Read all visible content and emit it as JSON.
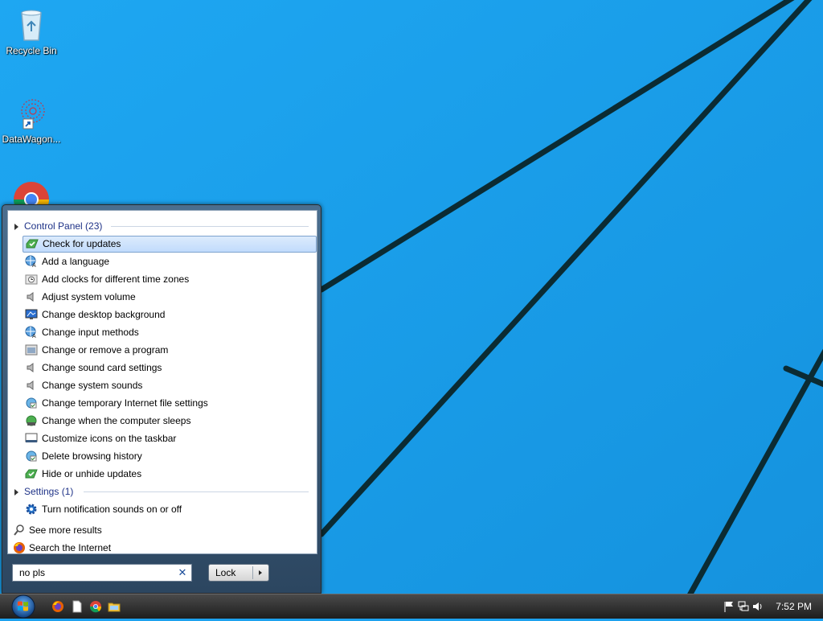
{
  "desktop": {
    "icons": [
      {
        "label": "Recycle Bin"
      },
      {
        "label": "DataWagon..."
      },
      {
        "label": ""
      }
    ]
  },
  "start_menu": {
    "groups": [
      {
        "header": "Control Panel (23)",
        "items": [
          {
            "label": "Check for updates",
            "icon": "windows-update-icon",
            "selected": true
          },
          {
            "label": "Add a language",
            "icon": "language-globe-icon"
          },
          {
            "label": "Add clocks for different time zones",
            "icon": "clock-region-icon"
          },
          {
            "label": "Adjust system volume",
            "icon": "speaker-icon"
          },
          {
            "label": "Change desktop background",
            "icon": "monitor-icon"
          },
          {
            "label": "Change input methods",
            "icon": "language-globe-icon"
          },
          {
            "label": "Change or remove a program",
            "icon": "programs-icon"
          },
          {
            "label": "Change sound card settings",
            "icon": "speaker-icon"
          },
          {
            "label": "Change system sounds",
            "icon": "speaker-icon"
          },
          {
            "label": "Change temporary Internet file settings",
            "icon": "internet-options-icon"
          },
          {
            "label": "Change when the computer sleeps",
            "icon": "power-options-icon"
          },
          {
            "label": "Customize icons on the taskbar",
            "icon": "taskbar-icon"
          },
          {
            "label": "Delete browsing history",
            "icon": "internet-options-icon"
          },
          {
            "label": "Hide or unhide updates",
            "icon": "windows-update-icon"
          }
        ]
      },
      {
        "header": "Settings (1)",
        "items": [
          {
            "label": "Turn notification sounds on or off",
            "icon": "gear-icon"
          }
        ]
      }
    ],
    "extra": {
      "see_more": "See more results",
      "search_internet": "Search the Internet"
    },
    "search": {
      "value": "no pls",
      "clear_symbol": "✕"
    },
    "lock_button": {
      "label": "Lock"
    }
  },
  "taskbar": {
    "pinned": [
      "firefox-icon",
      "notepad-icon",
      "chrome-icon",
      "explorer-icon"
    ],
    "tray": [
      "action-center-flag-icon",
      "network-icon",
      "volume-icon"
    ],
    "clock": "7:52 PM"
  },
  "colors": {
    "wallpaper": "#1da1ee",
    "selection": "#c1dbfc",
    "group_header_text": "#1e3287"
  }
}
